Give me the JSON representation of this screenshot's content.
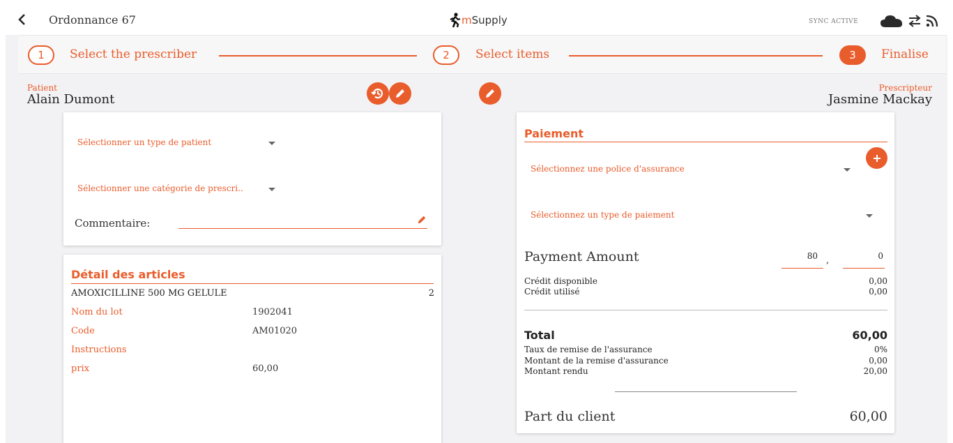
{
  "header": {
    "title": "Ordonnance 67",
    "brand": "mSupply",
    "brand_m": "m",
    "brand_rest": "Supply",
    "sync_status": "SYNC ACTIVE"
  },
  "stepper": {
    "steps": [
      {
        "number": "1",
        "label": "Select the prescriber"
      },
      {
        "number": "2",
        "label": "Select items"
      },
      {
        "number": "3",
        "label": "Finalise"
      }
    ]
  },
  "patient": {
    "label": "Patient",
    "name": "Alain Dumont"
  },
  "prescriber": {
    "label": "Prescripteur",
    "name": "Jasmine Mackay"
  },
  "patient_card": {
    "patient_type_placeholder": "Sélectionner un type de patient",
    "prescription_category_placeholder": "Sélectionner une catégorie de prescri..",
    "comment_label": "Commentaire:"
  },
  "items_card": {
    "title": "Détail des articles",
    "item_name": "AMOXICILLINE 500 MG GELULE",
    "item_quantity": "2",
    "rows": [
      {
        "label": "Nom du lot",
        "value": "1902041"
      },
      {
        "label": "Code",
        "value": "AM01020"
      },
      {
        "label": "Instructions",
        "value": ""
      },
      {
        "label": "prix",
        "value": "60,00"
      }
    ]
  },
  "payment_card": {
    "title": "Paiement",
    "insurance_placeholder": "Sélectionnez une police d'assurance",
    "payment_type_placeholder": "Sélectionnez un type de paiement",
    "payment_amount_label": "Payment Amount",
    "amount_whole": "80",
    "amount_separator": ",",
    "amount_decimal": "0",
    "credit_available_label": "Crédit disponible",
    "credit_available_value": "0,00",
    "credit_used_label": "Crédit utilisé",
    "credit_used_value": "0,00",
    "total_label": "Total",
    "total_value": "60,00",
    "discount_rate_label": "Taux de remise de l'assurance",
    "discount_rate_value": "0%",
    "discount_amount_label": "Montant de la remise d'assurance",
    "discount_amount_value": "0,00",
    "change_label": "Montant rendu",
    "change_value": "20,00",
    "client_share_label": "Part du client",
    "client_share_value": "60,00"
  },
  "colors": {
    "accent": "#e95c2b",
    "background": "#f2f2f4"
  }
}
